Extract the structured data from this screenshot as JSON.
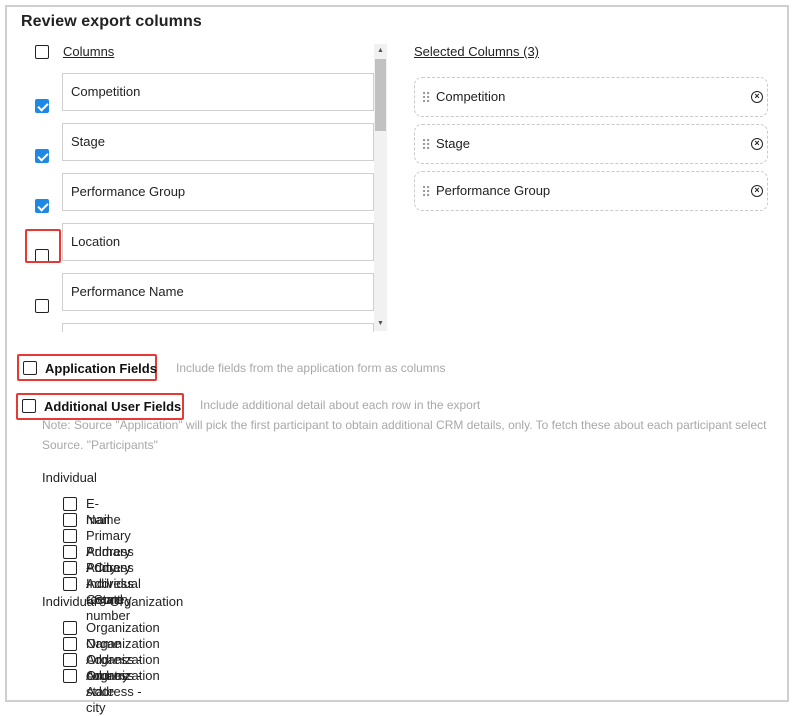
{
  "dialog": {
    "title": "Review export columns"
  },
  "columns": {
    "header": "Columns",
    "items": [
      {
        "label": "Competition",
        "checked": true
      },
      {
        "label": "Stage",
        "checked": true
      },
      {
        "label": "Performance Group",
        "checked": true
      },
      {
        "label": "Location",
        "checked": false
      },
      {
        "label": "Performance Name",
        "checked": false
      },
      {
        "label": "",
        "checked": false
      }
    ]
  },
  "selected": {
    "header": "Selected Columns (3)",
    "items": [
      {
        "label": "Competition"
      },
      {
        "label": "Stage"
      },
      {
        "label": "Performance Group"
      }
    ]
  },
  "options": {
    "application_fields": {
      "label": "Application Fields",
      "description": "Include fields from the application form as columns",
      "checked": false
    },
    "additional_user_fields": {
      "label": "Additional User Fields",
      "description": "Include additional detail about each row in the export",
      "checked": false
    },
    "note": "Note: Source \"Application\" will pick the first participant to obtain additional CRM details, only. To fetch these about each participant select Source. \"Participants\""
  },
  "individual": {
    "header": "Individual",
    "fields": [
      {
        "label": "E-mail"
      },
      {
        "label": "Name"
      },
      {
        "label": "Primary Address - City"
      },
      {
        "label": "Primary Address - Country"
      },
      {
        "label": "Primary Address - State"
      },
      {
        "label": "Individual record number"
      }
    ]
  },
  "organization": {
    "header": "Individual's Organization",
    "fields": [
      {
        "label": "Organization Name"
      },
      {
        "label": "Organization Address - country"
      },
      {
        "label": "Organization Address - state"
      },
      {
        "label": "Organization Address - city"
      }
    ]
  },
  "colors": {
    "accent": "#1e88e5",
    "highlight": "#e53935",
    "muted_text": "#a8a8a8"
  }
}
